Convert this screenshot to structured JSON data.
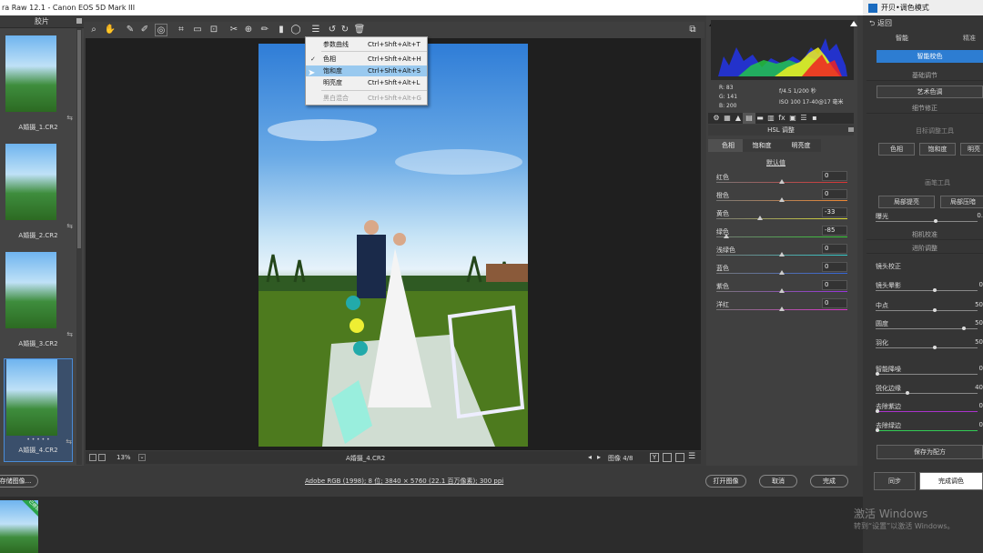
{
  "window_title": "ra Raw 12.1 -  Canon EOS 5D Mark III",
  "right_window_title": "开贝•调色模式",
  "filmstrip": {
    "header": "胶片",
    "items": [
      {
        "name": "A婚摄_1.CR2"
      },
      {
        "name": "A婚摄_2.CR2"
      },
      {
        "name": "A婚摄_3.CR2"
      },
      {
        "name": "A婚摄_4.CR2",
        "stars": "• • • • •",
        "selected": true
      }
    ]
  },
  "menu": {
    "items": [
      {
        "label": "参数曲线",
        "shortcut": "Ctrl+Shft+Alt+T"
      },
      {
        "label": "色相",
        "shortcut": "Ctrl+Shft+Alt+H",
        "checked": true
      },
      {
        "label": "饱和度",
        "shortcut": "Ctrl+Shft+Alt+S",
        "highlighted": true
      },
      {
        "label": "明亮度",
        "shortcut": "Ctrl+Shft+Alt+L"
      },
      {
        "label": "黑白混合",
        "shortcut": "Ctrl+Shft+Alt+G",
        "disabled": true
      }
    ]
  },
  "image_info": {
    "r": "R:  83",
    "g": "G:  141",
    "b": "B:  200",
    "exposure": "f/4.5  1/200 秒",
    "iso": "ISO 100   17-40@17 毫米"
  },
  "hsl": {
    "title": "HSL 调整",
    "tabs": [
      "色相",
      "饱和度",
      "明亮度"
    ],
    "default_link": "默认值",
    "rows": [
      {
        "label": "红色",
        "value": "0",
        "pos": 0.5,
        "color": "#d33"
      },
      {
        "label": "橙色",
        "value": "0",
        "pos": 0.5,
        "color": "#e83"
      },
      {
        "label": "黄色",
        "value": "-33",
        "pos": 0.335,
        "color": "#dd3"
      },
      {
        "label": "绿色",
        "value": "-85",
        "pos": 0.075,
        "color": "#3c3"
      },
      {
        "label": "浅绿色",
        "value": "0",
        "pos": 0.5,
        "color": "#3cc"
      },
      {
        "label": "蓝色",
        "value": "0",
        "pos": 0.5,
        "color": "#36d"
      },
      {
        "label": "紫色",
        "value": "0",
        "pos": 0.5,
        "color": "#93d"
      },
      {
        "label": "洋红",
        "value": "0",
        "pos": 0.5,
        "color": "#d3c"
      }
    ]
  },
  "bottom": {
    "zoom": "13%",
    "filename": "A婚摄_4.CR2",
    "counter": "图像 4/8"
  },
  "status": {
    "save_button": "存储图像...",
    "workflow_link": "Adobe RGB (1998); 8 位; 3840 × 5760 (22.1 百万像素); 300 ppi",
    "open_button": "打开图像",
    "cancel_button": "取消",
    "done_button": "完成"
  },
  "right_panel": {
    "back": "返回",
    "tab_smart": "智能",
    "tab_fine": "精准",
    "smart_color_button": "智能校色",
    "sec_basic": "基础调节",
    "art_color_button": "艺术色调",
    "sec_detail": "细节修正",
    "target_tools": "目标调整工具",
    "target_buttons": [
      "色相",
      "饱和度",
      "明亮"
    ],
    "brush_tools": "画笔工具",
    "brush_buttons": [
      "局部提亮",
      "局部压暗"
    ],
    "exposure_label": "曝光",
    "exposure_value": "0.",
    "sec_camera": "相机校准",
    "sec_advanced": "进阶调整",
    "lens_label": "镜头校正",
    "rows": [
      {
        "label": "镜头晕影",
        "value": "0",
        "pos": 0.58
      },
      {
        "label": "中点",
        "value": "50",
        "pos": 0.58
      },
      {
        "label": "圆度",
        "value": "50",
        "pos": 0.88
      },
      {
        "label": "羽化",
        "value": "50",
        "pos": 0.58
      },
      {
        "label": "智能降噪",
        "value": "0",
        "pos": 0.0
      },
      {
        "label": "锐化边缘",
        "value": "40",
        "pos": 0.31
      },
      {
        "label": "去除紫边",
        "value": "0",
        "pos": 0.0
      },
      {
        "label": "去除绿边",
        "value": "0",
        "pos": 0.0
      }
    ],
    "save_preset": "保存为配方",
    "sync": "同步",
    "finish": "完成调色"
  },
  "activation": {
    "line1": "激活 Windows",
    "line2": "转到“设置”以激活 Windows。"
  },
  "strip_badge": "已修饰"
}
